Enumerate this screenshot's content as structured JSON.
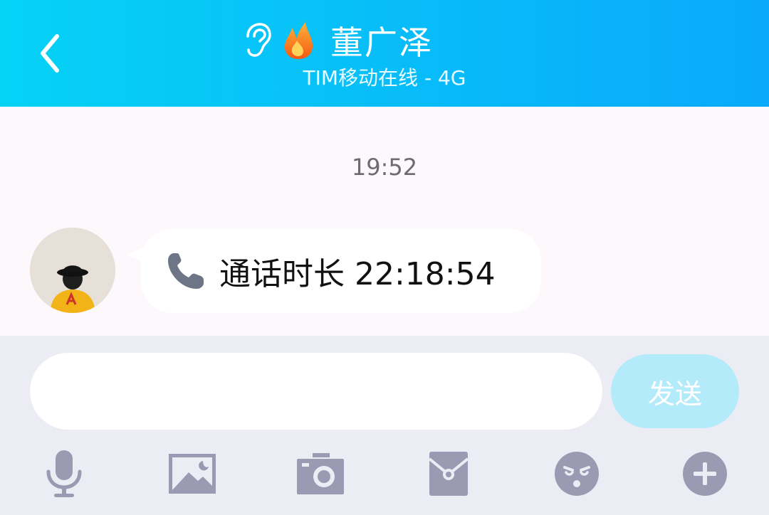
{
  "header": {
    "title": "董广泽",
    "subtitle": "TIM移动在线 - 4G",
    "back_icon": "chevron-left-icon",
    "earpiece_icon": "ear-icon",
    "streak_icon": "flame-icon"
  },
  "chat": {
    "timestamp": "19:52",
    "messages": [
      {
        "sender": "contact",
        "type": "call-record",
        "icon": "phone-icon",
        "text": "通话时长 22:18:54"
      }
    ]
  },
  "composer": {
    "input_value": "",
    "send_label": "发送"
  },
  "toolbar": {
    "items": [
      "microphone-icon",
      "image-icon",
      "camera-icon",
      "red-packet-icon",
      "emoji-icon",
      "plus-icon"
    ]
  },
  "colors": {
    "header_start": "#06d2f6",
    "header_end": "#0aa9fb",
    "send_button": "#b4ebfb",
    "toolbar_icon": "#9a9ab2"
  }
}
